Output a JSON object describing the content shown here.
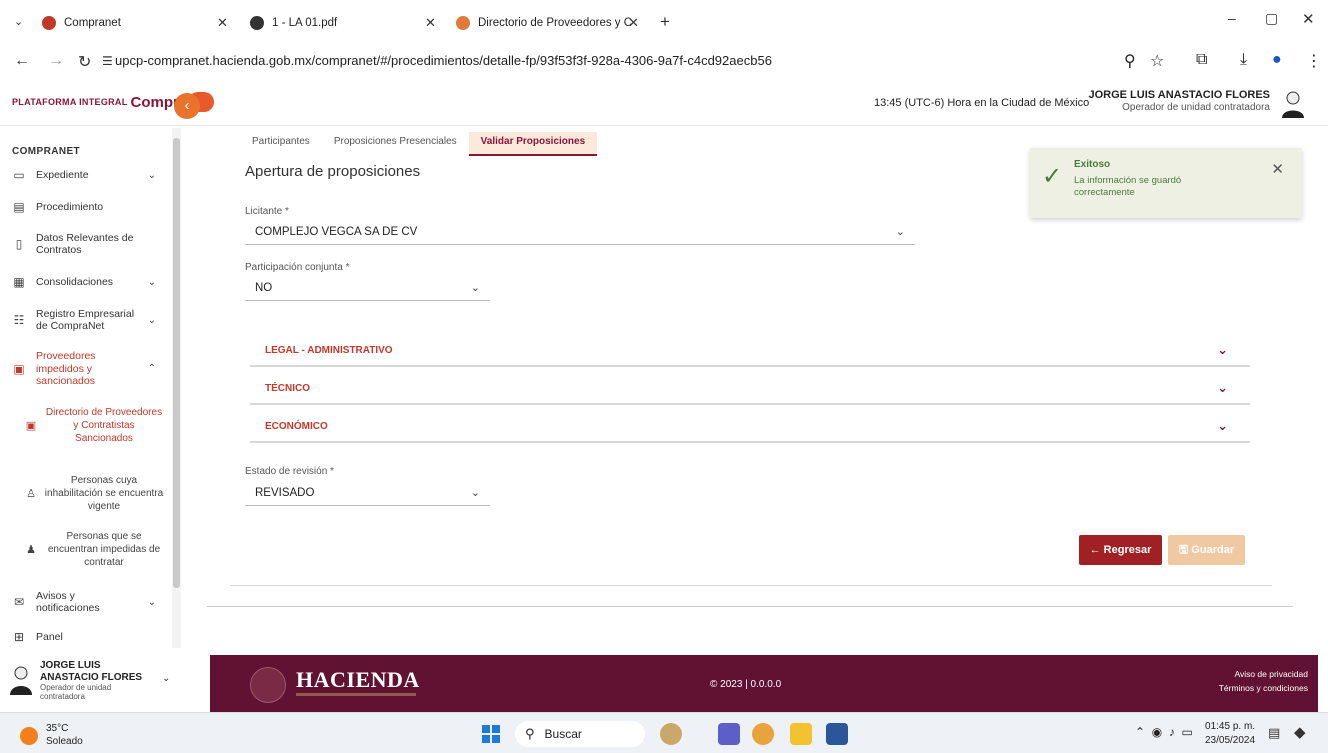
{
  "browser": {
    "tabs": [
      {
        "label": "Compranet",
        "favicon_color": "#c0392b"
      },
      {
        "label": "1 - LA 01.pdf",
        "favicon_color": "#333333"
      },
      {
        "label": "Directorio de Proveedores y C",
        "favicon_color": "#e07a3a"
      }
    ],
    "url": "upcp-compranet.hacienda.gob.mx/compranet/#/procedimientos/detalle-fp/93f53f3f-928a-4306-9a7f-c4cd92aecb56"
  },
  "header": {
    "logo_small": "PLATAFORMA INTEGRAL",
    "logo_main": "Compra",
    "time": "13:45 (UTC-6) Hora en la Ciudad de México",
    "user_name": "JORGE LUIS ANASTACIO FLORES",
    "user_role": "Operador de unidad contratadora"
  },
  "sidebar": {
    "title": "COMPRANET",
    "items": [
      {
        "label": "Expediente",
        "icon": "folder-icon"
      },
      {
        "label": "Procedimiento",
        "icon": "document-icon"
      },
      {
        "label": "Datos Relevantes de Contratos",
        "icon": "bookmark-icon"
      },
      {
        "label": "Consolidaciones",
        "icon": "calendar-icon"
      },
      {
        "label": "Registro Empresarial de CompraNet",
        "icon": "registry-icon"
      },
      {
        "label": "Proveedores impedidos y sancionados",
        "icon": "briefcase-icon"
      },
      {
        "label": "Avisos y notificaciones",
        "icon": "mail-icon"
      },
      {
        "label": "Panel",
        "icon": "panel-icon"
      }
    ],
    "subitems": [
      {
        "label": "Directorio de Proveedores y Contratistas Sancionados",
        "icon": "briefcase-icon"
      },
      {
        "label": "Personas cuya inhabilitación se encuentra vigente",
        "icon": "person-icon"
      },
      {
        "label": "Personas que se encuentran impedidas de contratar",
        "icon": "group-icon"
      }
    ],
    "user_name": "JORGE LUIS ANASTACIO FLORES",
    "user_role": "Operador de unidad contratadora"
  },
  "main": {
    "tabs": [
      "Participantes",
      "Proposiciones Presenciales",
      "Validar Proposiciones"
    ],
    "title": "Apertura de proposiciones",
    "licitante_label": "Licitante *",
    "licitante_value": "COMPLEJO VEGCA SA DE CV",
    "conjunta_label": "Participación conjunta *",
    "conjunta_value": "NO",
    "sections": [
      "LEGAL - ADMINISTRATIVO",
      "TÉCNICO",
      "ECONÓMICO"
    ],
    "estado_label": "Estado de revisión *",
    "estado_value": "REVISADO",
    "back_button": "← Regresar",
    "save_button": "🖫 Guardar"
  },
  "toast": {
    "title": "Exitoso",
    "message": "La información se guardó correctamente"
  },
  "footer": {
    "brand": "HACIENDA",
    "copyright": "© 2023 | 0.0.0.0",
    "privacy": "Aviso de privacidad",
    "terms": "Términos y condiciones"
  },
  "taskbar": {
    "temperature": "35°C",
    "weather": "Soleado",
    "search": "Buscar",
    "time": "01:45 p. m.",
    "date": "23/05/2024"
  },
  "colors": {
    "brand": "#8a1538",
    "accent": "#c0392b",
    "footer": "#611232",
    "success_bg": "#eef0e4"
  }
}
